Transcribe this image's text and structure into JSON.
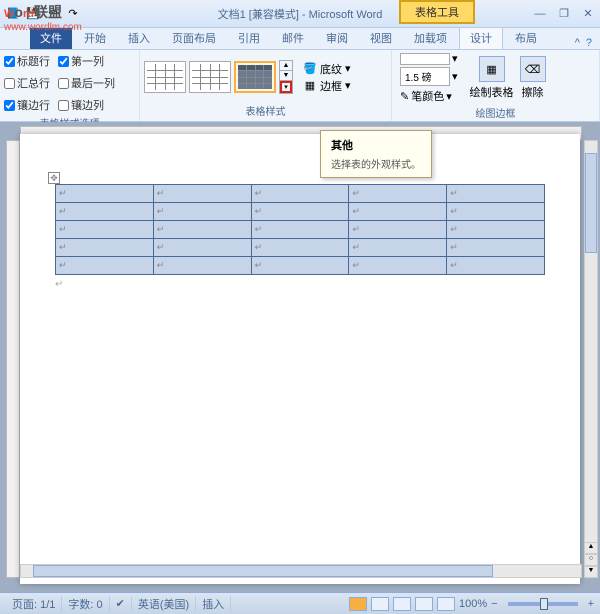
{
  "watermark": {
    "brand1_a": "W",
    "brand1_b": "o",
    "brand1_c": "rd",
    "brand2": "联盟",
    "url": "www.wordlm.com"
  },
  "title": "文档1 [兼容模式] - Microsoft Word",
  "context_tab": "表格工具",
  "tabs": {
    "file": "文件",
    "home": "开始",
    "insert": "插入",
    "layout": "页面布局",
    "ref": "引用",
    "mail": "邮件",
    "review": "审阅",
    "view": "视图",
    "addin": "加载项",
    "design": "设计",
    "tbl_layout": "布局"
  },
  "options": {
    "header_row": "标题行",
    "first_col": "第一列",
    "total_row": "汇总行",
    "last_col": "最后一列",
    "banded_row": "镶边行",
    "banded_col": "镶边列",
    "group_label": "表格样式选项"
  },
  "styles": {
    "group_label": "表格样式",
    "shading": "底纹",
    "borders": "边框"
  },
  "draw": {
    "weight": "1.5 磅",
    "pen_color": "笔颜色",
    "draw_table": "绘制表格",
    "eraser": "擦除",
    "group_label": "绘图边框"
  },
  "tooltip": {
    "title": "其他",
    "desc": "选择表的外观样式。"
  },
  "status": {
    "page": "页面: 1/1",
    "words": "字数: 0",
    "lang": "英语(美国)",
    "insert": "插入",
    "zoom": "100%"
  }
}
